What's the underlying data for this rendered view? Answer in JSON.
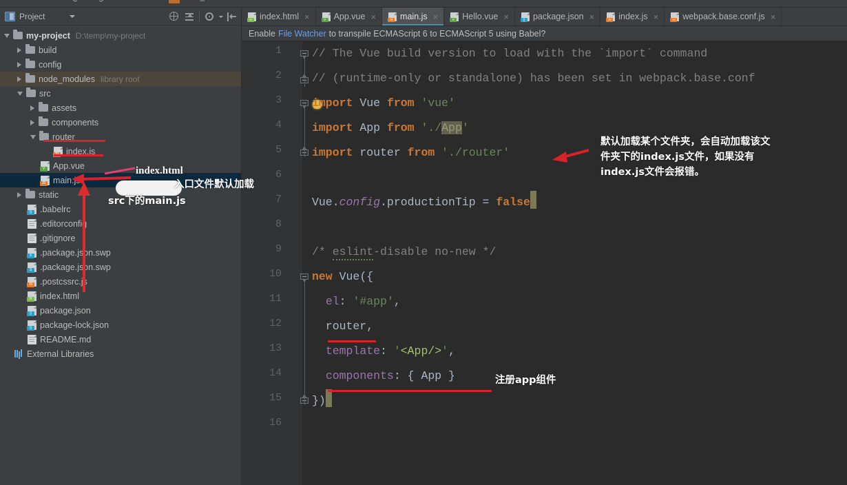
{
  "window": {
    "theme_bg": "#3c3f41",
    "editor_bg": "#2b2b2b",
    "accent": "#4a8fa8",
    "annotation_color": "#d8232a"
  },
  "sidebar": {
    "title": "Project",
    "tools": [
      {
        "name": "collapse-all-icon",
        "label": "Collapse All"
      },
      {
        "name": "expand-icon",
        "label": "Expand"
      },
      {
        "name": "settings-gear-icon",
        "label": "Settings"
      },
      {
        "name": "hide-panel-icon",
        "label": "Hide"
      }
    ],
    "tree": [
      {
        "label": "my-project",
        "hint": "D:\\temp\\my-project",
        "indent": 0,
        "state": "open",
        "kind": "root",
        "bold": true
      },
      {
        "label": "build",
        "hint": "",
        "indent": 1,
        "state": "closed",
        "kind": "folder"
      },
      {
        "label": "config",
        "hint": "",
        "indent": 1,
        "state": "closed",
        "kind": "folder"
      },
      {
        "label": "node_modules",
        "hint": "library root",
        "indent": 1,
        "state": "closed",
        "kind": "folder",
        "highlight": true
      },
      {
        "label": "src",
        "hint": "",
        "indent": 1,
        "state": "open",
        "kind": "folder"
      },
      {
        "label": "assets",
        "hint": "",
        "indent": 2,
        "state": "closed",
        "kind": "folder"
      },
      {
        "label": "components",
        "hint": "",
        "indent": 2,
        "state": "closed",
        "kind": "folder"
      },
      {
        "label": "router",
        "hint": "",
        "indent": 2,
        "state": "open",
        "kind": "folder"
      },
      {
        "label": "index.js",
        "hint": "",
        "indent": 3,
        "state": "none",
        "kind": "file",
        "ftype": "js"
      },
      {
        "label": "App.vue",
        "hint": "",
        "indent": 2,
        "state": "none",
        "kind": "file",
        "ftype": "vue"
      },
      {
        "label": "main.js",
        "hint": "",
        "indent": 2,
        "state": "none",
        "kind": "file",
        "ftype": "js",
        "selected": true
      },
      {
        "label": "static",
        "hint": "",
        "indent": 1,
        "state": "closed",
        "kind": "folder"
      },
      {
        "label": ".babelrc",
        "hint": "",
        "indent": 1,
        "state": "none",
        "kind": "file",
        "ftype": "json"
      },
      {
        "label": ".editorconfig",
        "hint": "",
        "indent": 1,
        "state": "none",
        "kind": "file",
        "ftype": "plain"
      },
      {
        "label": ".gitignore",
        "hint": "",
        "indent": 1,
        "state": "none",
        "kind": "file",
        "ftype": "plain"
      },
      {
        "label": ".package.json.swp",
        "hint": "",
        "indent": 1,
        "state": "none",
        "kind": "file",
        "ftype": "swp"
      },
      {
        "label": ".package.json.swp",
        "hint": "",
        "indent": 1,
        "state": "none",
        "kind": "file",
        "ftype": "swp"
      },
      {
        "label": ".postcssrc.js",
        "hint": "",
        "indent": 1,
        "state": "none",
        "kind": "file",
        "ftype": "js"
      },
      {
        "label": "index.html",
        "hint": "",
        "indent": 1,
        "state": "none",
        "kind": "file",
        "ftype": "html"
      },
      {
        "label": "package.json",
        "hint": "",
        "indent": 1,
        "state": "none",
        "kind": "file",
        "ftype": "json"
      },
      {
        "label": "package-lock.json",
        "hint": "",
        "indent": 1,
        "state": "none",
        "kind": "file",
        "ftype": "json"
      },
      {
        "label": "README.md",
        "hint": "",
        "indent": 1,
        "state": "none",
        "kind": "file",
        "ftype": "plain"
      },
      {
        "label": "External Libraries",
        "hint": "",
        "indent": 0,
        "state": "none",
        "kind": "extlib"
      }
    ]
  },
  "editor": {
    "tabs": [
      {
        "label": "index.html",
        "ftype": "html",
        "active": false,
        "close": "×"
      },
      {
        "label": "App.vue",
        "ftype": "vue",
        "active": false,
        "close": "×"
      },
      {
        "label": "main.js",
        "ftype": "js",
        "active": true,
        "close": "×"
      },
      {
        "label": "Hello.vue",
        "ftype": "vue",
        "active": false,
        "close": "×"
      },
      {
        "label": "package.json",
        "ftype": "json",
        "active": false,
        "close": "×"
      },
      {
        "label": "index.js",
        "ftype": "js",
        "active": false,
        "close": "×"
      },
      {
        "label": "webpack.base.conf.js",
        "ftype": "js",
        "active": false,
        "close": "×"
      }
    ],
    "notification": {
      "prefix": "Enable",
      "link": "File Watcher",
      "suffix": "to transpile ECMAScript 6 to ECMAScript 5 using Babel?"
    },
    "line_numbers": [
      "1",
      "2",
      "3",
      "4",
      "5",
      "6",
      "7",
      "8",
      "9",
      "10",
      "11",
      "12",
      "13",
      "14",
      "15",
      "16"
    ],
    "code_lines": [
      "// The Vue build version to load with the `import` command",
      "// (runtime-only or standalone) has been set in webpack.base.conf",
      "import Vue from 'vue'",
      "import App from './App'",
      "import router from './router'",
      "",
      "Vue.config.productionTip = false",
      "",
      "/* eslint-disable no-new */",
      "new Vue({",
      "  el: '#app',",
      "  router,",
      "  template: '<App/>',",
      "  components: { App }",
      "})",
      ""
    ]
  },
  "annotations": {
    "index_html_label": "index.html",
    "entry_note_line1": "入口文件默认加载",
    "entry_note_line2": "src下的main.js",
    "router_note_line1": "默认加载某个文件夹，会自动加载该文",
    "router_note_line2": "件夹下的index.js文件，如果没有",
    "router_note_line3": "index.js文件会报错。",
    "components_note": "注册app组件"
  }
}
